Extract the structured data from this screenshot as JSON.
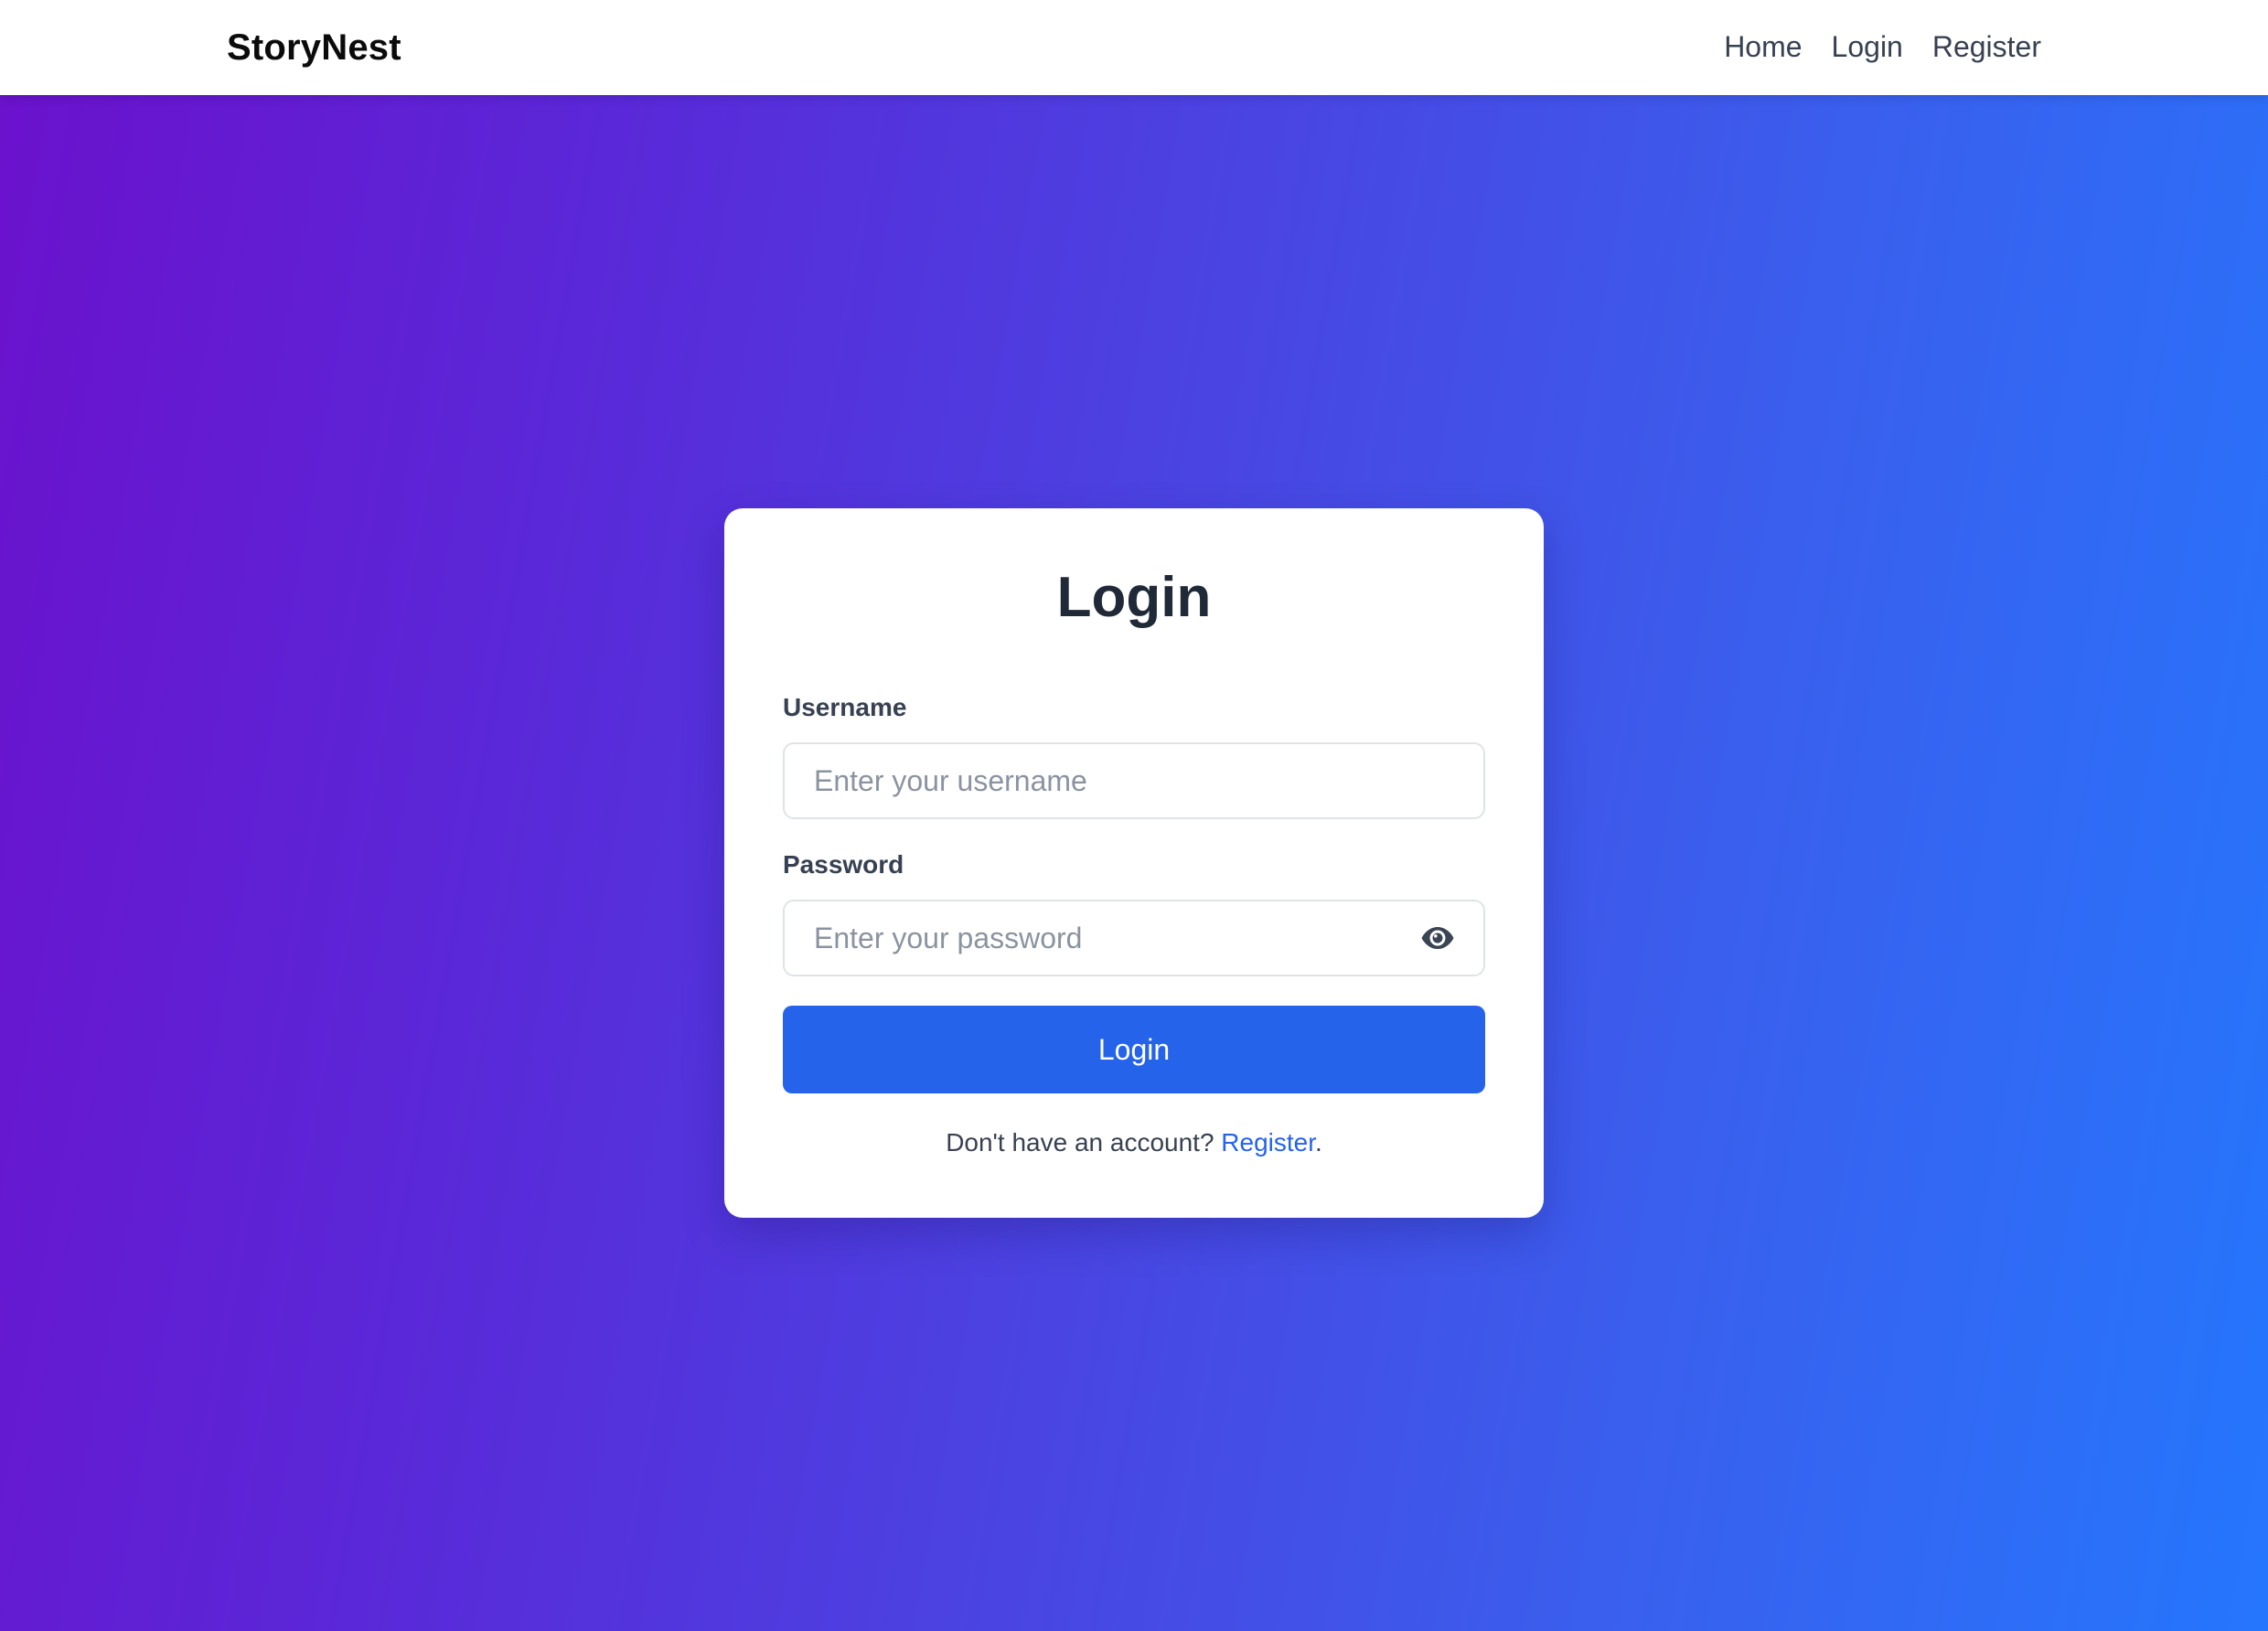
{
  "navbar": {
    "brand": "StoryNest",
    "links": [
      {
        "label": "Home"
      },
      {
        "label": "Login"
      },
      {
        "label": "Register"
      }
    ]
  },
  "login_card": {
    "title": "Login",
    "username": {
      "label": "Username",
      "placeholder": "Enter your username",
      "value": ""
    },
    "password": {
      "label": "Password",
      "placeholder": "Enter your password",
      "value": "",
      "toggle_icon": "eye-icon"
    },
    "submit_label": "Login",
    "footer": {
      "prompt": "Don't have an account? ",
      "link_label": "Register",
      "suffix": "."
    }
  },
  "colors": {
    "gradient_start": "#6b11cc",
    "gradient_end": "#2576fd",
    "primary_button": "#2563eb",
    "link": "#2563eb",
    "title_text": "#1f2937"
  }
}
